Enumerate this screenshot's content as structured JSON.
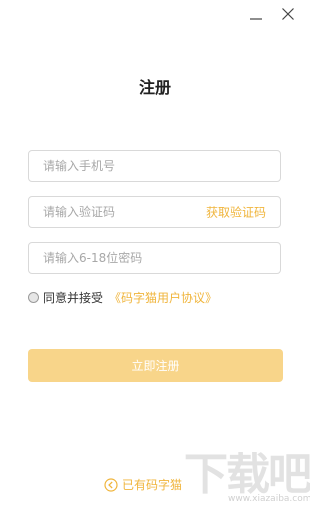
{
  "window": {
    "minimize_icon": "minimize-icon",
    "close_icon": "close-icon"
  },
  "title": "注册",
  "form": {
    "phone_placeholder": "请输入手机号",
    "code_placeholder": "请输入验证码",
    "get_code_label": "获取验证码",
    "password_placeholder": "请输入6-18位密码"
  },
  "agreement": {
    "text": "同意并接受",
    "link": "《码字猫用户协议》"
  },
  "register_button": "立即注册",
  "back_link": "已有码字猫",
  "watermark": {
    "text": "下载吧",
    "url": "www.xiazaiba.com"
  },
  "colors": {
    "accent": "#f0b53c",
    "button_bg": "#f8d58a",
    "border": "#d9d9d9",
    "placeholder": "#a8a8a8"
  }
}
